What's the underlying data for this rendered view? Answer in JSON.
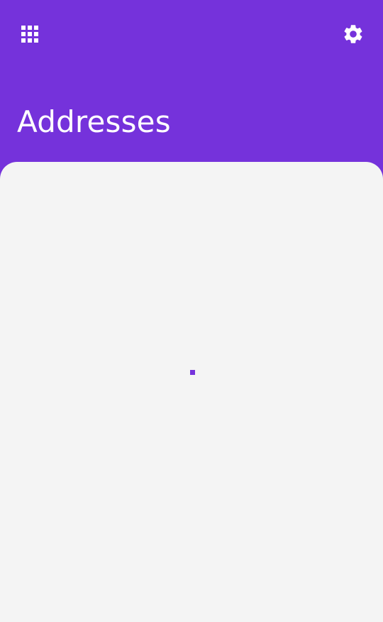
{
  "header": {
    "title": "Addresses",
    "apps_icon": "apps-grid-icon",
    "settings_icon": "gear-icon"
  },
  "colors": {
    "primary": "#7532db",
    "surface": "#f4f4f4",
    "on_primary": "#ffffff"
  },
  "content": {
    "state": "loading"
  }
}
